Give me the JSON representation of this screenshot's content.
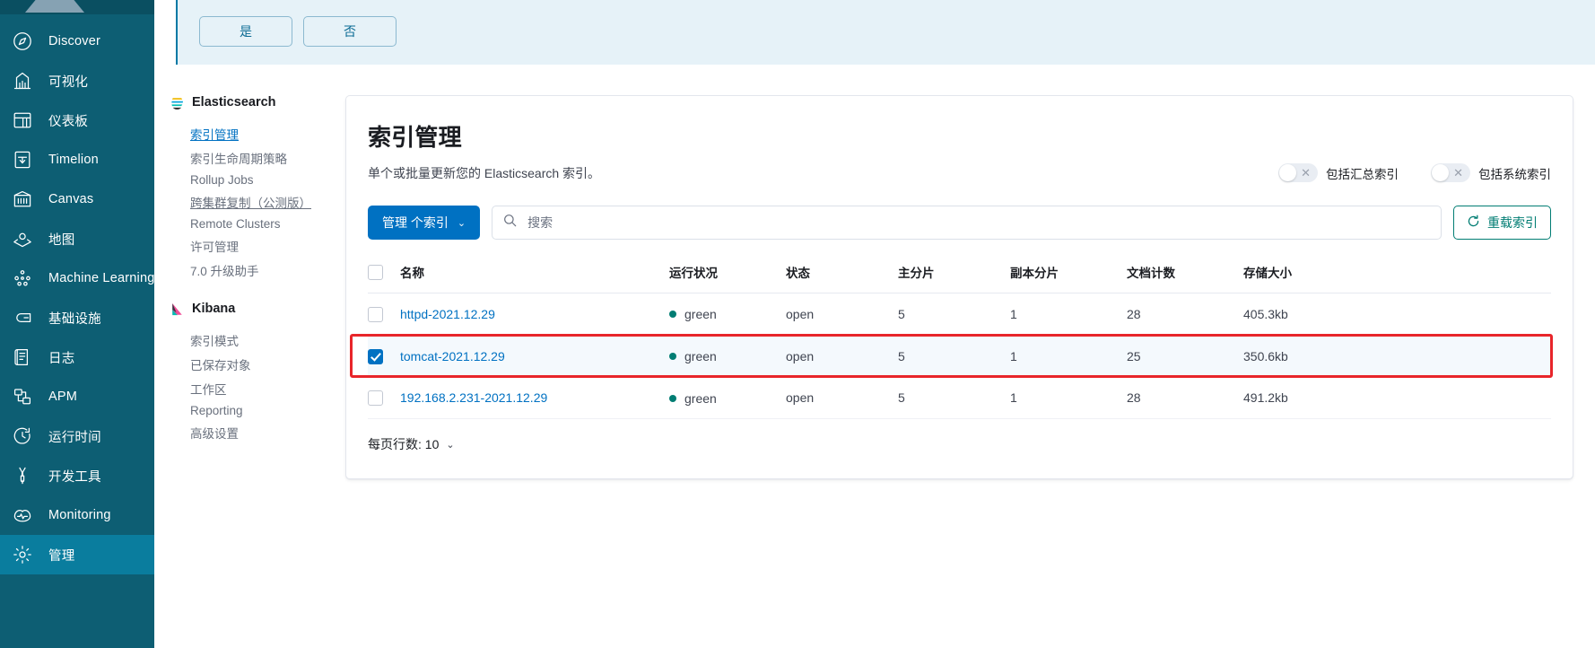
{
  "global_nav": {
    "items": [
      {
        "label": "Discover",
        "icon": "compass-icon",
        "selected": false
      },
      {
        "label": "可视化",
        "icon": "bar-chart-icon",
        "selected": false
      },
      {
        "label": "仪表板",
        "icon": "dashboard-icon",
        "selected": false
      },
      {
        "label": "Timelion",
        "icon": "timelion-icon",
        "selected": false
      },
      {
        "label": "Canvas",
        "icon": "canvas-icon",
        "selected": false
      },
      {
        "label": "地图",
        "icon": "map-layers-icon",
        "selected": false
      },
      {
        "label": "Machine Learning",
        "icon": "machine-learning-icon",
        "selected": false
      },
      {
        "label": "基础设施",
        "icon": "infrastructure-icon",
        "selected": false
      },
      {
        "label": "日志",
        "icon": "logs-icon",
        "selected": false
      },
      {
        "label": "APM",
        "icon": "apm-icon",
        "selected": false
      },
      {
        "label": "运行时间",
        "icon": "uptime-icon",
        "selected": false
      },
      {
        "label": "开发工具",
        "icon": "wrench-icon",
        "selected": false
      },
      {
        "label": "Monitoring",
        "icon": "monitoring-icon",
        "selected": false
      },
      {
        "label": "管理",
        "icon": "gear-icon",
        "selected": true
      }
    ]
  },
  "callout": {
    "text": "",
    "yes_label": "是",
    "no_label": "否"
  },
  "mgmt_nav": {
    "sections": [
      {
        "title": "Elasticsearch",
        "logo": "elasticsearch-logo",
        "links": [
          {
            "label": "索引管理",
            "state": "active"
          },
          {
            "label": "索引生命周期策略",
            "state": "normal"
          },
          {
            "label": "Rollup Jobs",
            "state": "normal"
          },
          {
            "label": "跨集群复制（公测版）",
            "state": "underlined"
          },
          {
            "label": "Remote Clusters",
            "state": "normal"
          },
          {
            "label": "许可管理",
            "state": "normal"
          },
          {
            "label": "7.0 升级助手",
            "state": "normal"
          }
        ]
      },
      {
        "title": "Kibana",
        "logo": "kibana-logo",
        "links": [
          {
            "label": "索引模式",
            "state": "normal"
          },
          {
            "label": "已保存对象",
            "state": "normal"
          },
          {
            "label": "工作区",
            "state": "normal"
          },
          {
            "label": "Reporting",
            "state": "normal"
          },
          {
            "label": "高级设置",
            "state": "normal"
          }
        ]
      }
    ]
  },
  "panel": {
    "title": "索引管理",
    "subtitle": "单个或批量更新您的 Elasticsearch 索引。",
    "toggles": [
      {
        "label": "包括汇总索引",
        "on": false,
        "icon": "toggle-off-x-icon"
      },
      {
        "label": "包括系统索引",
        "on": false,
        "icon": "toggle-off-x-icon"
      }
    ],
    "manage_button": "管理 个索引",
    "manage_caret": "⌄",
    "search_placeholder": "搜索",
    "search_value": "",
    "search_icon": "search-icon",
    "reload_button": "重载索引",
    "reload_icon": "refresh-icon",
    "table": {
      "columns": [
        "名称",
        "运行状况",
        "状态",
        "主分片",
        "副本分片",
        "文档计数",
        "存储大小"
      ],
      "rows": [
        {
          "selected": false,
          "highlighted": false,
          "name": "httpd-2021.12.29",
          "health": "green",
          "status": "open",
          "primaries": "5",
          "replicas": "1",
          "docs": "28",
          "size": "405.3kb"
        },
        {
          "selected": true,
          "highlighted": true,
          "name": "tomcat-2021.12.29",
          "health": "green",
          "status": "open",
          "primaries": "5",
          "replicas": "1",
          "docs": "25",
          "size": "350.6kb"
        },
        {
          "selected": false,
          "highlighted": false,
          "name": "192.168.2.231-2021.12.29",
          "health": "green",
          "status": "open",
          "primaries": "5",
          "replicas": "1",
          "docs": "28",
          "size": "491.2kb"
        }
      ]
    },
    "pagination": {
      "label": "每页行数: 10",
      "caret": "⌄"
    }
  },
  "colors": {
    "nav_bg": "#0d5e73",
    "nav_selected": "#0a7d9e",
    "primary": "#0071c2",
    "health_green": "#017d73",
    "highlight_red": "#e8252a",
    "callout_bg": "#e6f2f8"
  }
}
